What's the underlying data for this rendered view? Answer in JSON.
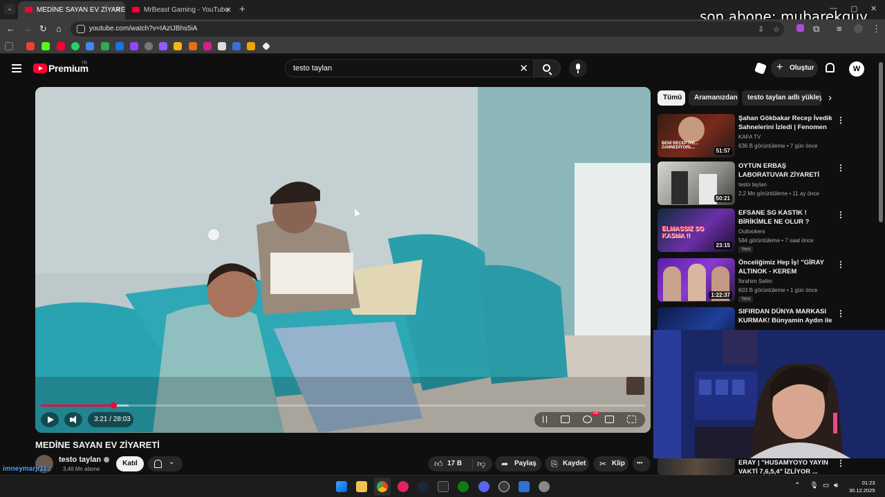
{
  "browser": {
    "tabs": [
      {
        "title": "MEDİNE SAYAN EV ZİYARETİ - YouTube",
        "active": true
      },
      {
        "title": "MrBeast Gaming - YouTube",
        "active": false
      }
    ],
    "url": "youtube.com/watch?v=IAzIJBhs5iA",
    "new_tab_label": "+",
    "window_controls": [
      "—",
      "▢",
      "✕"
    ]
  },
  "stream_overlay": {
    "last_subscriber": "son abone: mubarekguy",
    "chat_user": "imneymarjr11 :"
  },
  "youtube": {
    "brand": "Premium",
    "country_code": "TR",
    "search_query": "testo taylan",
    "create_label": "Oluştur",
    "account_initial": "W"
  },
  "player": {
    "current_time": "3:21 / 28:03",
    "played_fraction": 0.12,
    "buffered_fraction": 0.145,
    "hd_badge": "HD"
  },
  "video": {
    "title": "MEDİNE SAYAN EV ZİYARETİ",
    "channel": "testo taylan",
    "subscribers": "3,46 Mn abone",
    "join_label": "Katıl",
    "likes": "17 B",
    "share_label": "Paylaş",
    "save_label": "Kaydet",
    "clip_label": "Klip",
    "more_label": "•••"
  },
  "sidebar": {
    "chips": [
      "Tümü",
      "Aramanızdan",
      "testo taylan adlı yükleyiciden"
    ],
    "recommendations": [
      {
        "title": "Şahan Gökbakar Recep İvedik Sahnelerini İzledi | Fenomen ...",
        "channel": "KAFA TV",
        "meta": "636 B görüntüleme • 7 gün önce",
        "duration": "51:57",
        "new": "",
        "thumb_text": "BENİ RECEP İVE... ZANNEDİYORL..."
      },
      {
        "title": "OYTUN ERBAŞ LABORATUVAR ZİYARETİ",
        "channel": "testo taylan",
        "meta": "2,2 Mn görüntüleme • 11 ay önce",
        "duration": "50:21",
        "new": "",
        "thumb_text": ""
      },
      {
        "title": "EFSANE SG KASTIK ! BİRİKİMLE NE OLUR ? LEGEND ONLİNE ...",
        "channel": "Outlookers",
        "meta": "584 görüntüleme • 7 saat önce",
        "duration": "23:15",
        "new": "Yeni",
        "thumb_text": "ELMASSIZ SG KASMA !!"
      },
      {
        "title": "Önceliğimiz Hep İş! \"GİRAY ALTINOK - KEREM ÖZDOĞAN\" ...",
        "channel": "İbrahim Selim",
        "meta": "603 B görüntüleme • 1 gün önce",
        "duration": "1:22:37",
        "new": "Yeni",
        "thumb_text": ""
      },
      {
        "title": "SIFIRDAN DÜNYA MARKASI KURMAK! Bünyamin Aydın ile ...",
        "channel": "",
        "meta": "",
        "duration": "",
        "new": "",
        "thumb_text": ""
      },
      {
        "title": "ERAY | \"HUSAMYOYO YAYIN VAKTİ 7,6,5,4\" İZLİYOR ...",
        "channel": "",
        "meta": "",
        "duration": "",
        "new": "",
        "thumb_text": ""
      }
    ]
  },
  "taskbar": {
    "time": "01:23",
    "date": "30.12.2025"
  },
  "colors": {
    "accent": "#ff0033",
    "background": "#0f0f0f",
    "chip_bg": "#272727"
  }
}
